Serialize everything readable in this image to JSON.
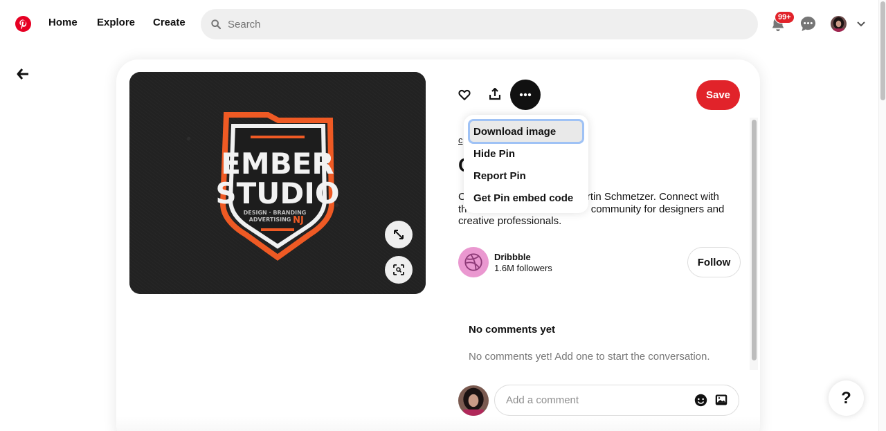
{
  "header": {
    "logo_icon": "pinterest-logo-icon",
    "brand_color": "#e60023",
    "nav": [
      {
        "label": "Home"
      },
      {
        "label": "Explore"
      },
      {
        "label": "Create"
      }
    ],
    "search": {
      "placeholder": "Search",
      "value": ""
    },
    "notifications_badge": "99+",
    "icons": [
      "bell-icon",
      "chat-icon",
      "avatar",
      "chevron-down-icon"
    ]
  },
  "pin": {
    "image_alt": "Ember Studio logo - Design Branding Advertising NJ",
    "logo_text": {
      "line1": "EMBER",
      "line2": "STUDIO",
      "tag1": "DESIGN · BRANDING",
      "tag2": "ADVERTISING",
      "tag3": "NJ"
    },
    "source_link": "c",
    "title": "C",
    "description": "C                                        artin Schmetzer. Connect with th                                           community for designers and creative professionals.",
    "save_label": "Save",
    "creator": {
      "name": "Dribbble",
      "followers": "1.6M followers",
      "follow_label": "Follow"
    },
    "comments": {
      "title": "No comments yet",
      "empty_text": "No comments yet! Add one to start the conversation."
    },
    "comment_input": {
      "placeholder": "Add a comment",
      "value": ""
    }
  },
  "more_menu": {
    "items": [
      {
        "label": "Download image",
        "active": true
      },
      {
        "label": "Hide Pin"
      },
      {
        "label": "Report Pin"
      },
      {
        "label": "Get Pin embed code"
      }
    ]
  },
  "help_label": "?"
}
